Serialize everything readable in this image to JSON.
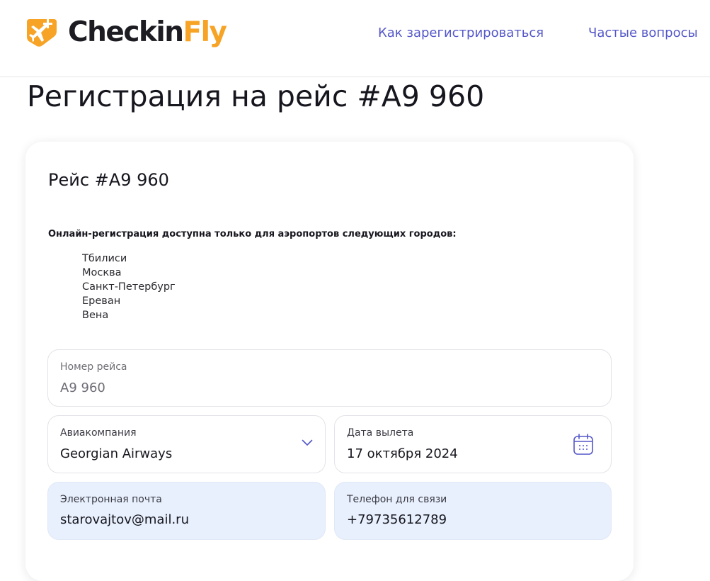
{
  "header": {
    "logo": {
      "name_part1": "Checkin",
      "name_part2": "Fly",
      "icon": "plane-plus-icon",
      "accent_color": "#f7a325"
    },
    "nav": [
      {
        "label": "Как зарегистрироваться"
      },
      {
        "label": "Частые вопросы"
      }
    ],
    "link_color": "#5457c9"
  },
  "page": {
    "title": "Регистрация на рейс #A9 960"
  },
  "card": {
    "title": "Рейс #A9 960",
    "notice": "Онлайн-регистрация доступна только для аэропортов следующих городов:",
    "cities": [
      "Тбилиси",
      "Москва",
      "Санкт-Петербург",
      "Ереван",
      "Вена"
    ]
  },
  "form": {
    "flight_number": {
      "label": "Номер рейса",
      "value": "A9 960"
    },
    "airline": {
      "label": "Авиакомпания",
      "value": "Georgian Airways",
      "icon": "chevron-down-icon"
    },
    "departure_date": {
      "label": "Дата вылета",
      "value": "17 октября 2024",
      "icon": "calendar-icon"
    },
    "email": {
      "label": "Электронная почта",
      "value": "starovajtov@mail.ru"
    },
    "phone": {
      "label": "Телефон для связи",
      "value": "+79735612789"
    },
    "filled_bg": "#e8f0fd"
  }
}
